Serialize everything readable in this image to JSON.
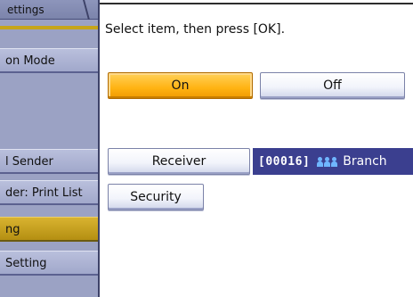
{
  "sidebar": {
    "tab_label": "ettings",
    "items": [
      {
        "label": "on Mode"
      },
      {
        "label": "l Sender"
      },
      {
        "label": "der: Print List"
      },
      {
        "label": "ng"
      },
      {
        "label": "Setting"
      }
    ]
  },
  "main": {
    "instruction": "Select item, then press [OK].",
    "on_label": "On",
    "off_label": "Off",
    "receiver_label": "Receiver",
    "security_label": "Security",
    "destination": {
      "code": "[00016]",
      "icon": "group-icon",
      "name": "Branch"
    }
  },
  "colors": {
    "active": "#ffb313",
    "destination_bg": "#3b3f8f",
    "sidebar_bg": "#9ba2c4",
    "sidebar_selected": "#c6a51a"
  }
}
